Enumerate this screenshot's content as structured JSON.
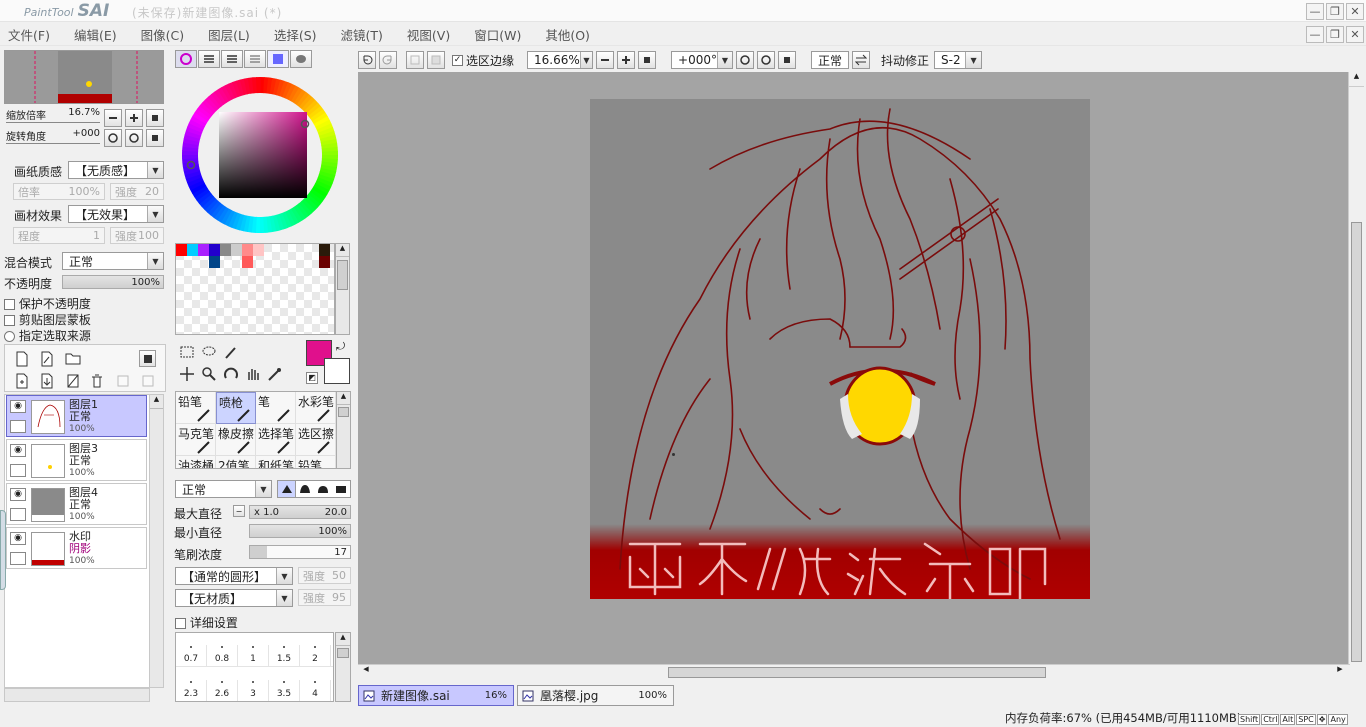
{
  "app": {
    "logo_small": "PaintTool",
    "logo_big": "SAI",
    "title": "(未保存)新建图像.sai (*)"
  },
  "window_buttons": {
    "minimize": "—",
    "restore": "❐",
    "close": "✕"
  },
  "menu": [
    "文件(F)",
    "编辑(E)",
    "图像(C)",
    "图层(L)",
    "选择(S)",
    "滤镜(T)",
    "视图(V)",
    "窗口(W)",
    "其他(O)"
  ],
  "navigator": {
    "zoom_label": "缩放倍率",
    "zoom_value": "16.7%",
    "rotate_label": "旋转角度",
    "rotate_value": "+000"
  },
  "paper": {
    "texture_label": "画纸质感",
    "texture_value": "【无质感】",
    "rate_label": "倍率",
    "rate_value": "100%",
    "strength_label": "强度",
    "strength_value": "20",
    "effect_label": "画材效果",
    "effect_value": "【无效果】",
    "degree_label": "程度",
    "degree_value": "1",
    "strength2_label": "强度",
    "strength2_value": "100"
  },
  "layer_props": {
    "blend_label": "混合模式",
    "blend_value": "正常",
    "opacity_label": "不透明度",
    "opacity_value": "100%",
    "opacity_fraction": 1.0,
    "protect_opacity": "保护不透明度",
    "clip_mask": "剪贴图层蒙板",
    "selection_source": "指定选取来源"
  },
  "layers": [
    {
      "name": "图层1",
      "mode": "正常",
      "opacity": "100%",
      "selected": true,
      "thumb": "sketch"
    },
    {
      "name": "图层3",
      "mode": "正常",
      "opacity": "100%",
      "selected": false,
      "thumb": "dot"
    },
    {
      "name": "图层4",
      "mode": "正常",
      "opacity": "100%",
      "selected": false,
      "thumb": "gray"
    },
    {
      "name": "水印",
      "mode": "阴影",
      "opacity": "100%",
      "selected": false,
      "thumb": "watermark"
    }
  ],
  "colors": {
    "primary": "#e0108c",
    "secondary": "#ffffff",
    "swatches_row1": [
      "#ff0000",
      "#00ccff",
      "#aa22ff",
      "#2200cc",
      "#888888",
      "#cccccc",
      "#ff8a8a",
      "#ffc4c4",
      "",
      "",
      "",
      "",
      "",
      "#2a1a0a"
    ],
    "swatches_row2": [
      "",
      "",
      "",
      "#004488",
      "",
      "",
      "#ff5a5a",
      "",
      "",
      "",
      "",
      "",
      "",
      "#6a0000"
    ]
  },
  "tools": [
    {
      "name": "铅笔",
      "selected": false
    },
    {
      "name": "喷枪",
      "selected": true
    },
    {
      "name": "笔",
      "selected": false
    },
    {
      "name": "水彩笔",
      "selected": false
    },
    {
      "name": "马克笔",
      "selected": false
    },
    {
      "name": "橡皮擦",
      "selected": false
    },
    {
      "name": "选择笔",
      "selected": false
    },
    {
      "name": "选区擦",
      "selected": false
    },
    {
      "name": "油漆桶",
      "selected": false
    },
    {
      "name": "2值笔",
      "selected": false
    },
    {
      "name": "和纸笔",
      "selected": false
    },
    {
      "name": "铅笔30",
      "selected": false
    }
  ],
  "brush": {
    "mode_value": "正常",
    "max_diam_label": "最大直径",
    "max_diam_mult": "x 1.0",
    "max_diam_value": "20.0",
    "min_diam_label": "最小直径",
    "min_diam_value": "100%",
    "density_label": "笔刷浓度",
    "density_value": "17",
    "shape_value": "【通常的圆形】",
    "shape_strength_label": "强度",
    "shape_strength_value": "50",
    "texture_value": "【无材质】",
    "texture_strength_label": "强度",
    "texture_strength_value": "95",
    "detail_label": "详细设置",
    "sizes_row1": [
      "0.7",
      "0.8",
      "1",
      "1.5",
      "2"
    ],
    "sizes_row2": [
      "2.3",
      "2.6",
      "3",
      "3.5",
      "4"
    ]
  },
  "toolbar": {
    "selection_edge_label": "选区边缘",
    "zoom_value": "16.66%",
    "angle_value": "+000°",
    "mode_value": "正常",
    "stabilizer_label": "抖动修正",
    "stabilizer_value": "S-2"
  },
  "canvas": {
    "watermark_text": "雨不微凉水印"
  },
  "tabs": [
    {
      "name": "新建图像.sai",
      "zoom": "16%",
      "active": true
    },
    {
      "name": "凰落樱.jpg",
      "zoom": "100%",
      "active": false
    }
  ],
  "status": {
    "memory": "内存负荷率:67% (已用454MB/可用1110MB)",
    "keys": [
      "Shift",
      "Ctrl",
      "Alt",
      "SPC",
      "Any"
    ]
  }
}
